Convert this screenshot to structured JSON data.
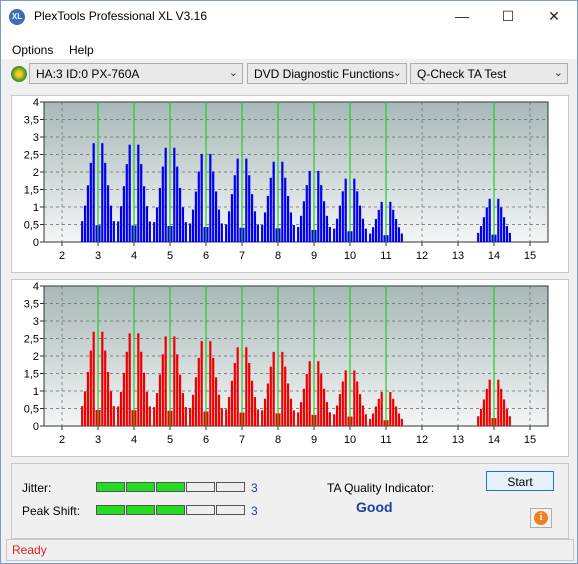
{
  "window": {
    "title": "PlexTools Professional XL V3.16",
    "minimize": "—",
    "maximize": "☐",
    "close": "✕"
  },
  "menu": {
    "options": "Options",
    "help": "Help"
  },
  "toolbar": {
    "drive": "HA:3 ID:0  PX-760A",
    "function": "DVD Diagnostic Functions",
    "test": "Q-Check TA Test"
  },
  "chart_data": [
    {
      "type": "bar",
      "color": "#0000ee",
      "xlim": [
        1.5,
        15.5
      ],
      "ylim": [
        0,
        4
      ],
      "x_ticks": [
        "2",
        "3",
        "4",
        "5",
        "6",
        "7",
        "8",
        "9",
        "10",
        "11",
        "12",
        "13",
        "14",
        "15"
      ],
      "y_ticks": [
        "0",
        "0,5",
        "1",
        "1,5",
        "2",
        "2,5",
        "3",
        "3,5",
        "4"
      ],
      "green_markers": [
        3,
        4,
        5,
        6,
        7,
        8,
        9,
        10,
        11,
        14
      ],
      "clusters": [
        {
          "center": 3.0,
          "peak": 3.2
        },
        {
          "center": 4.0,
          "peak": 3.15
        },
        {
          "center": 5.0,
          "peak": 3.05
        },
        {
          "center": 6.0,
          "peak": 2.85
        },
        {
          "center": 7.0,
          "peak": 2.7
        },
        {
          "center": 8.0,
          "peak": 2.6
        },
        {
          "center": 9.0,
          "peak": 2.3
        },
        {
          "center": 10.0,
          "peak": 2.05
        },
        {
          "center": 11.0,
          "peak": 1.3
        },
        {
          "center": 14.0,
          "peak": 1.4
        }
      ]
    },
    {
      "type": "bar",
      "color": "#ee0000",
      "xlim": [
        1.5,
        15.5
      ],
      "ylim": [
        0,
        4
      ],
      "x_ticks": [
        "2",
        "3",
        "4",
        "5",
        "6",
        "7",
        "8",
        "9",
        "10",
        "11",
        "12",
        "13",
        "14",
        "15"
      ],
      "y_ticks": [
        "0",
        "0,5",
        "1",
        "1,5",
        "2",
        "2,5",
        "3",
        "3,5",
        "4"
      ],
      "green_markers": [
        3,
        4,
        5,
        6,
        7,
        8,
        9,
        10,
        11,
        14
      ],
      "clusters": [
        {
          "center": 3.0,
          "peak": 3.05
        },
        {
          "center": 4.0,
          "peak": 3.0
        },
        {
          "center": 5.0,
          "peak": 2.9
        },
        {
          "center": 6.0,
          "peak": 2.75
        },
        {
          "center": 7.0,
          "peak": 2.55
        },
        {
          "center": 8.0,
          "peak": 2.4
        },
        {
          "center": 9.0,
          "peak": 2.1
        },
        {
          "center": 10.0,
          "peak": 1.8
        },
        {
          "center": 11.0,
          "peak": 1.1
        },
        {
          "center": 14.0,
          "peak": 1.5
        }
      ]
    }
  ],
  "metrics": {
    "jitter_label": "Jitter:",
    "jitter_value": "3",
    "jitter_level": 3,
    "peak_label": "Peak Shift:",
    "peak_value": "3",
    "peak_level": 3,
    "segments": 5
  },
  "ta": {
    "label": "TA Quality Indicator:",
    "value": "Good"
  },
  "buttons": {
    "start": "Start"
  },
  "status": {
    "text": "Ready"
  }
}
